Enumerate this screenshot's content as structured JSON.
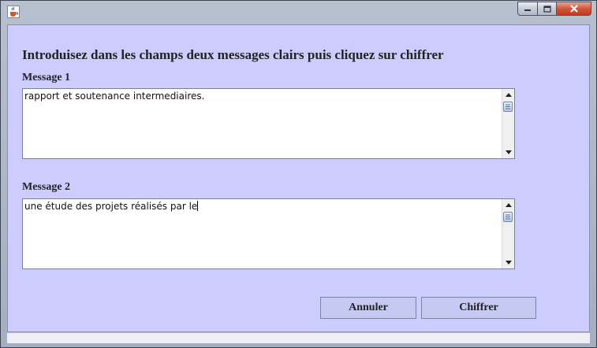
{
  "window": {
    "title": "",
    "icon": "java-cup-icon",
    "controls": [
      "minimize",
      "maximize",
      "close"
    ]
  },
  "dialog": {
    "heading": "Introduisez dans les champs deux messages clairs puis cliquez sur chiffrer",
    "message1": {
      "label": "Message 1",
      "value": "rapport et soutenance intermediaires."
    },
    "message2": {
      "label": "Message 2",
      "value": "une étude des projets réalisés par le"
    },
    "buttons": {
      "cancel": "Annuler",
      "encrypt": "Chiffrer"
    }
  },
  "colors": {
    "dialog_background": "#ccccff",
    "button_background": "#c6c9f2",
    "close_button": "#c13a1f"
  }
}
